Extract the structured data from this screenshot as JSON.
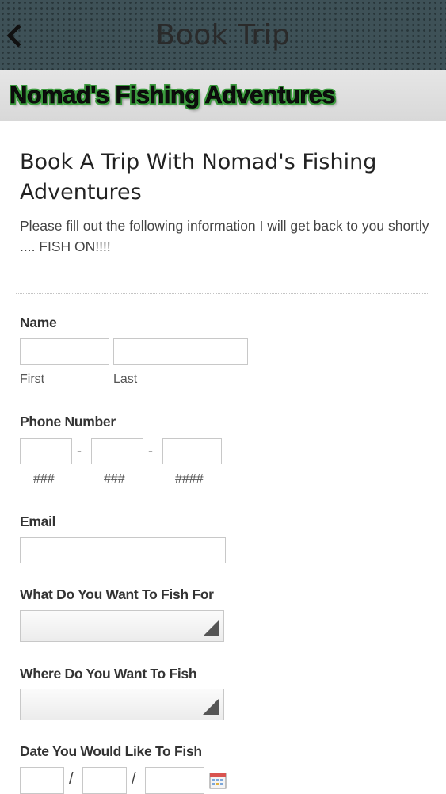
{
  "header": {
    "title": "Book Trip",
    "back_icon": "chevron-left-icon"
  },
  "banner": {
    "text": "Nomad's Fishing Adventures",
    "outline_color": "#3c9a3e"
  },
  "page": {
    "title": "Book A Trip With Nomad's Fishing Adventures",
    "subtitle": "Please fill out the following information I will get back to you shortly .... FISH ON!!!!"
  },
  "form": {
    "name": {
      "label": "Name",
      "first_label": "First",
      "last_label": "Last",
      "first_value": "",
      "last_value": ""
    },
    "phone": {
      "label": "Phone Number",
      "separator": "-",
      "area_hint": "###",
      "prefix_hint": "###",
      "line_hint": "####"
    },
    "email": {
      "label": "Email",
      "value": ""
    },
    "fish_for": {
      "label": "What Do You Want To Fish For",
      "selected": ""
    },
    "fish_where": {
      "label": "Where Do You Want To Fish",
      "selected": ""
    },
    "date": {
      "label": "Date You Would Like To Fish",
      "separator": "/",
      "calendar_icon": "calendar-icon"
    }
  },
  "colors": {
    "header_bg": "#3e5157",
    "banner_bg": "#dedede"
  }
}
